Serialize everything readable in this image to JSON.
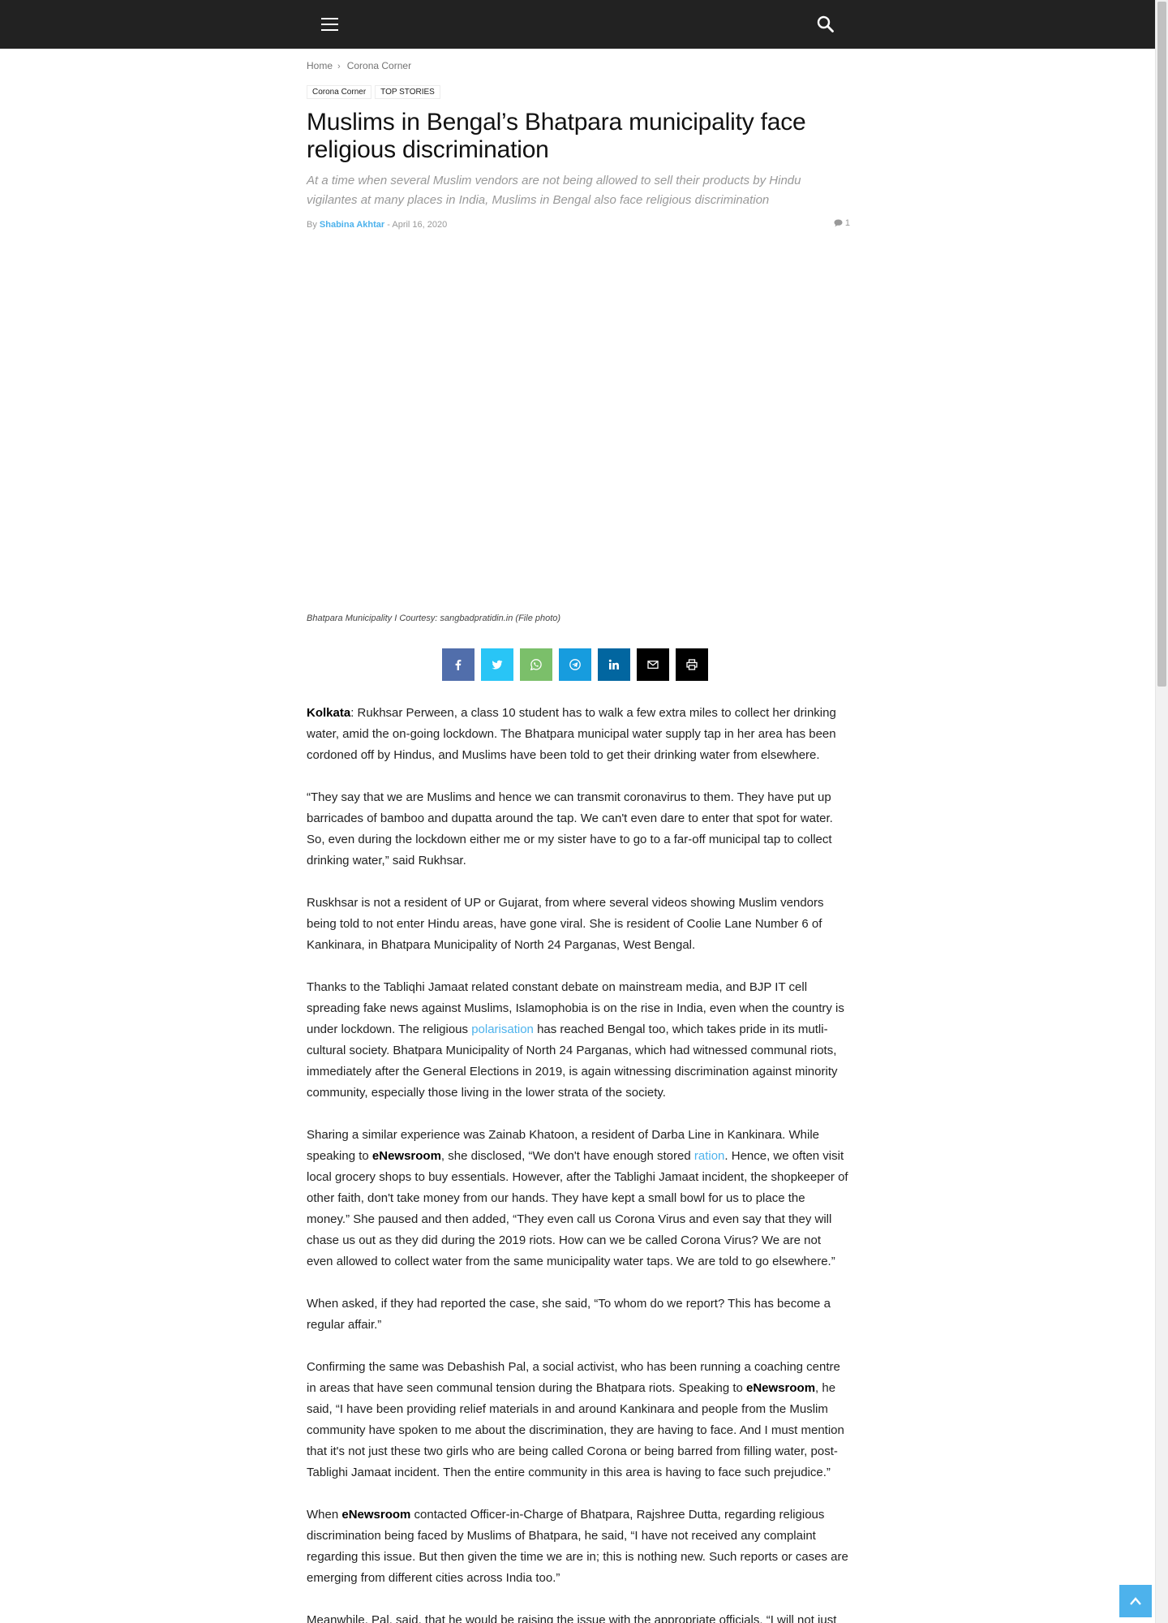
{
  "header": {
    "menu_icon": "hamburger-menu-icon",
    "search_icon": "search-icon",
    "background": "#222222"
  },
  "breadcrumb": {
    "items": [
      "Home",
      "Corona Corner"
    ]
  },
  "categories": [
    "Corona Corner",
    "TOP STORIES"
  ],
  "article": {
    "title": "Muslims in Bengal’s Bhatpara municipality face religious discrimination",
    "subtitle": "At a time when several Muslim vendors are not being allowed to sell their products by Hindu vigilantes at many places in India, Muslims in Bengal also face religious discrimination",
    "by_label": "By",
    "author": "Shabina Akhtar",
    "date_sep": "-",
    "date": "April 16, 2020",
    "comments_count": "1",
    "caption": "Bhatpara Municipality I Courtesy: sangbadpratidin.in (File photo)"
  },
  "share_buttons": [
    {
      "name": "facebook",
      "icon": "facebook-icon",
      "color": "#516eab"
    },
    {
      "name": "twitter",
      "icon": "twitter-icon",
      "color": "#29c5f6"
    },
    {
      "name": "whatsapp",
      "icon": "whatsapp-icon",
      "color": "#7bbf6a"
    },
    {
      "name": "telegram",
      "icon": "telegram-icon",
      "color": "#179cde"
    },
    {
      "name": "linkedin",
      "icon": "linkedin-icon",
      "color": "#0266a0"
    },
    {
      "name": "email",
      "icon": "email-icon",
      "color": "#000000"
    },
    {
      "name": "print",
      "icon": "print-icon",
      "color": "#000000"
    }
  ],
  "body": {
    "p1": {
      "lead": "Kolkata",
      "text": ": Rukhsar Perween, a class 10 student has to walk a few extra miles to collect her drinking water, amid the on-going lockdown. The Bhatpara municipal water supply tap in her area has been cordoned off by Hindus, and Muslims have been told to get their drinking water from elsewhere."
    },
    "p2": "“They say that we are Muslims and hence we can transmit coronavirus to them. They have put up barricades of bamboo and dupatta around the tap. We can't even dare to enter that spot for water. So, even during the lockdown either me or my sister have to go to a far-off municipal tap to collect drinking water,” said Rukhsar.",
    "p3": "Ruskhsar is not a resident of UP or Gujarat, from where several videos showing Muslim vendors being told to not enter Hindu areas, have gone viral. She is resident of Coolie Lane Number 6 of Kankinara, in Bhatpara Municipality of North 24 Parganas, West Bengal.",
    "p4": {
      "before": "Thanks to the Tabliqhi Jamaat related constant debate on mainstream media, and BJP IT cell spreading fake news against Muslims, Islamophobia is on the rise in India, even when the country is under lockdown. The religious ",
      "link": "polarisation",
      "after": " has reached Bengal too, which takes pride in its mutli-cultural society. Bhatpara Municipality of North 24 Parganas, which had witnessed communal riots, immediately after the General Elections in 2019, is again witnessing discrimination against minority community, especially those living in the lower strata of the society."
    },
    "p5": {
      "a": "Sharing a similar experience was Zainab Khatoon, a resident of Darba Line in Kankinara. While speaking to ",
      "brand": "eNewsroom",
      "b": ", she disclosed, “We don't have enough stored ",
      "link": "ration",
      "c": ". Hence, we often visit local grocery shops to buy essentials. However, after the Tablighi Jamaat incident, the shopkeeper of other faith, don't take money from our hands. They have kept a small bowl for us to place the money.” She paused and then added, “They even call us Corona Virus and even say that they will chase us out as they did during the 2019 riots. How can we be called Corona Virus? We are not even allowed to collect water from the same municipality water taps. We are told to go elsewhere.”"
    },
    "p6": "When asked, if they had reported the case, she said, “To whom do we report? This has become a regular affair.”",
    "p7": {
      "a": "Confirming the same was Debashish Pal, a social activist, who has been running a coaching centre in areas that have seen communal tension during the Bhatpara riots. Speaking to ",
      "brand": "eNewsroom",
      "b": ", he said, “I have been providing relief materials in and around Kankinara and people from the Muslim community have spoken to me about the discrimination, they are having to face. And I must mention that it's not just these two girls who are being called Corona or being barred from filling water, post-Tablighi Jamaat incident. Then the entire community in this area is having to face such prejudice.”"
    },
    "p8": {
      "a": "When ",
      "brand": "eNewsroom",
      "b": " contacted Officer-in-Charge of Bhatpara, Rajshree Dutta, regarding religious discrimination being faced by Muslims of Bhatpara, he said, “I have not received any complaint regarding this issue. But then given the time we are in; this is nothing new. Such reports or cases are emerging from different cities across India too.”"
    },
    "p9": "Meanwhile, Pal, said, that he would be raising the issue with the appropriate officials. “I will not just"
  },
  "scroll_top_icon": "chevron-up-icon",
  "accent_color": "#4db2ec"
}
